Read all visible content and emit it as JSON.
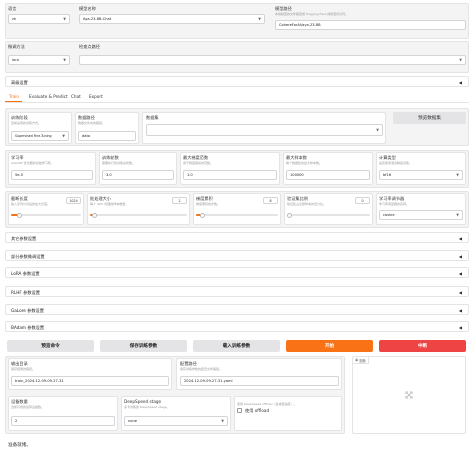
{
  "top": {
    "language": {
      "label": "语言",
      "value": "zh"
    },
    "model_name": {
      "label": "模型名称",
      "value": "Aya-23-8B-Chat"
    },
    "model_path": {
      "label": "模型路径",
      "hint": "本地模型的文件路径或 Hugging Face 的模型标识符。",
      "value": "CohereForAI/aya-23-8B"
    },
    "finetune": {
      "label": "微调方法",
      "value": "lora"
    },
    "checkpoint": {
      "label": "检查点路径",
      "value": ""
    }
  },
  "advanced": {
    "label": "高级设置"
  },
  "tabs": [
    {
      "label": "Train",
      "active": true
    },
    {
      "label": "Evaluate & Predict",
      "active": false
    },
    {
      "label": "Chat",
      "active": false
    },
    {
      "label": "Export",
      "active": false
    }
  ],
  "train": {
    "stage": {
      "label": "训练阶段",
      "hint": "目前采用的训练方式。",
      "value": "Supervised Fine-Tuning"
    },
    "dataset_dir": {
      "label": "数据路径",
      "hint": "数据文件夹的路径。",
      "value": "data"
    },
    "dataset": {
      "label": "数据集",
      "value": ""
    },
    "preview": {
      "label": "预览数据集"
    },
    "lr": {
      "label": "学习率",
      "hint": "AdamW 优化器的初始学习率。",
      "value": "5e-5"
    },
    "epochs": {
      "label": "训练轮数",
      "hint": "需要执行的训练总轮数。",
      "value": "3.0"
    },
    "max_grad": {
      "label": "最大梯度范数",
      "hint": "用于梯度裁剪的范数。",
      "value": "1.0"
    },
    "max_samples": {
      "label": "最大样本数",
      "hint": "每个数据集的最大样本数。",
      "value": "100000"
    },
    "compute": {
      "label": "计算类型",
      "hint": "是否使用混合精度训练。",
      "value": "bf16"
    },
    "cutoff": {
      "label": "截断长度",
      "hint": "输入序列分词后的最大长度。",
      "value": "1024",
      "level": 0.12
    },
    "batch": {
      "label": "批处理大小",
      "hint": "每个 GPU 处理的样本数量。",
      "value": "2",
      "level": 0.05
    },
    "grad_acc": {
      "label": "梯度累积",
      "hint": "梯度累积的步数。",
      "value": "8",
      "level": 0.08
    },
    "val_size": {
      "label": "验证集比例",
      "hint": "验证集占全部样本的百分比。",
      "value": "0",
      "level": 0
    },
    "scheduler": {
      "label": "学习率调节器",
      "hint": "学习率调度器的名称。",
      "value": "cosine"
    }
  },
  "sections": [
    {
      "label": "其它参数设置"
    },
    {
      "label": "部分参数微调设置"
    },
    {
      "label": "LoRA 参数设置"
    },
    {
      "label": "RLHF 参数设置"
    },
    {
      "label": "GaLore 参数设置"
    },
    {
      "label": "BAdam 参数设置"
    }
  ],
  "actions": {
    "preview_cmd": "预览命令",
    "save_args": "保存训练参数",
    "load_args": "载入训练参数",
    "start": "开始",
    "stop": "中断"
  },
  "output": {
    "output_dir": {
      "label": "输出目录",
      "hint": "保存结果的路径。",
      "value": "train_2024-12-09-09-27-31"
    },
    "config_path": {
      "label": "配置路径",
      "hint": "保存训练参数的配置文件路径。",
      "value": "2024-12-09-09-27-31.yaml"
    },
    "device": {
      "label": "设备数量",
      "hint": "当前可用的运算设备数。",
      "value": "2"
    },
    "ds_stage": {
      "label": "DeepSpeed stage",
      "hint": "多卡训练的 DeepSpeed stage。",
      "value": "none"
    },
    "ds_offload": {
      "label": "使用 offload",
      "hint": "使用 DeepSpeed offload（会减慢速度）。"
    },
    "plot": {
      "label": "图像"
    }
  },
  "status": "准备就绪。",
  "colors": {
    "accent": "#f97316",
    "stop": "#ef4444"
  }
}
